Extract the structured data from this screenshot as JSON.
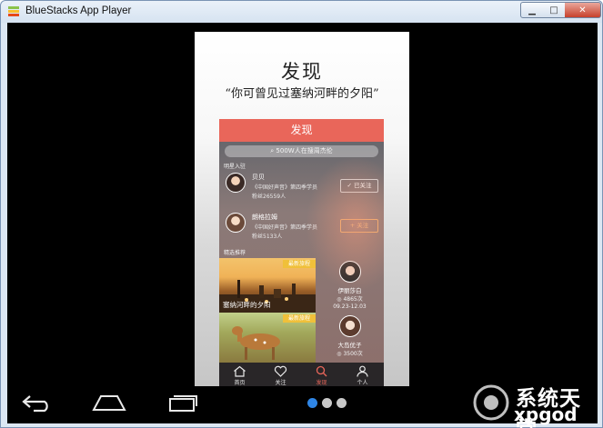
{
  "window": {
    "title": "BlueStacks App Player",
    "minimize_icon": "minimize-icon",
    "maximize_icon": "maximize-icon",
    "close_icon": "close-icon"
  },
  "intro": {
    "title": "发现",
    "subtitle": "“你可曾见过塞纳河畔的夕阳”"
  },
  "app": {
    "header_title": "发现",
    "search_placeholder": "500W人在搜周杰伦",
    "section_stars": "明星入驻",
    "stars": [
      {
        "name": "贝贝",
        "desc": "《中国好声音》第四季学员",
        "fans": "粉丝26559人",
        "button": "已关注",
        "button_icon": "check-icon"
      },
      {
        "name": "朗格拉姆",
        "desc": "《中国好声音》第四季学员",
        "fans": "粉丝5133人",
        "button": "关注",
        "button_icon": "plus-icon"
      }
    ],
    "section_featured": "精选推荐",
    "featured": [
      {
        "tag": "最新旅程",
        "caption": "塞纳河畔的夕阳",
        "author": "伊丽莎白",
        "views": "4865次",
        "date": "09.23-12.03"
      },
      {
        "tag": "最新旅程",
        "caption": "",
        "author": "大岛优子",
        "views": "3500次",
        "date": ""
      }
    ],
    "tabs": [
      {
        "label": "首页",
        "icon": "home-icon"
      },
      {
        "label": "关注",
        "icon": "heart-icon"
      },
      {
        "label": "发现",
        "icon": "search-icon"
      },
      {
        "label": "个人",
        "icon": "person-icon"
      }
    ],
    "active_tab": "发现",
    "accent_color": "#e9665a"
  },
  "android_nav": {
    "back_icon": "back-icon",
    "home_icon": "home-icon",
    "recents_icon": "recent-apps-icon",
    "pager_dots": 3,
    "pager_active": 1
  },
  "watermark": {
    "line1": "系统天堂",
    "line2": "xpgod"
  }
}
